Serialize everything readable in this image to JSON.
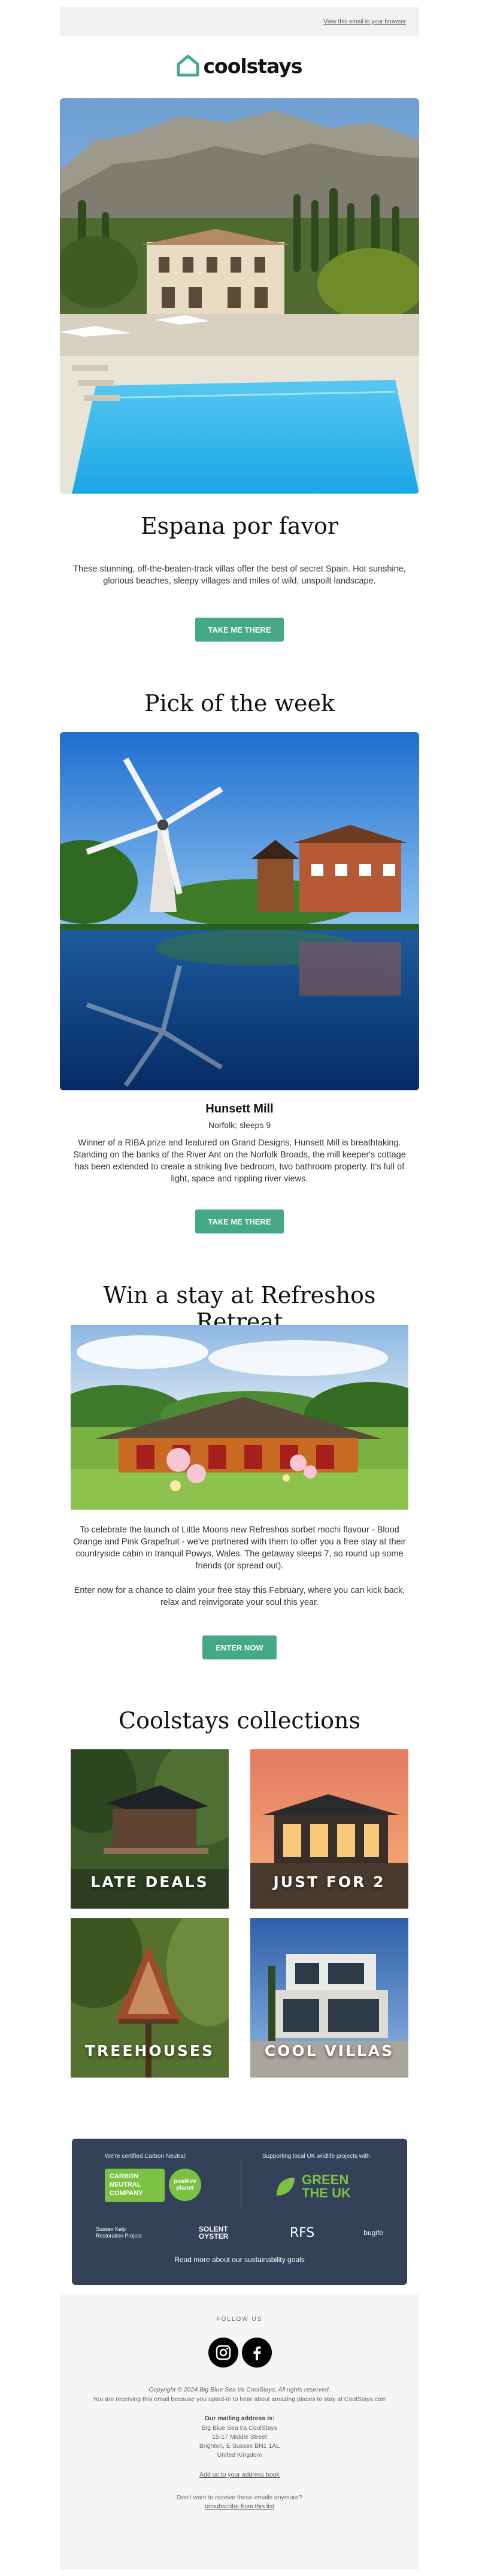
{
  "preheader": {
    "view_in_browser": "View this email in your browser"
  },
  "brand": {
    "name": "coolstays",
    "accent": "#44a889"
  },
  "hero": {
    "title": "Espana por favor",
    "text": "These stunning, off-the-beaten-track villas offer the best of secret Spain. Hot sunshine, glorious beaches, sleepy villages and miles of wild, unspoilt landscape.",
    "cta": "TAKE ME THERE"
  },
  "pick": {
    "heading": "Pick of the week",
    "name": "Hunsett Mill",
    "location": "Norfolk; sleeps 9",
    "text": "Winner of a RIBA prize and featured on Grand Designs, Hunsett Mill is breathtaking. Standing on the banks of the River Ant on the Norfolk Broads, the mill keeper's cottage has been extended to create a striking five bedroom, two bathroom property. It's full of light, space and rippling river views.",
    "cta": "TAKE ME THERE"
  },
  "competition": {
    "heading": "Win a stay at Refreshos Retreat",
    "text1": "To celebrate the launch of Little Moons new Refreshos sorbet mochi flavour - Blood Orange and Pink Grapefruit - we've partnered with them to offer you a free stay at their countryside cabin in tranquil Powys, Wales. The getaway sleeps 7, so round up some friends (or spread out).",
    "text2": "Enter now for a chance to claim your free stay this February, where you can kick back, relax and reinvigorate your soul this year.",
    "cta": "ENTER NOW"
  },
  "collections": {
    "heading": "Coolstays collections",
    "items": [
      {
        "label": "LATE DEALS"
      },
      {
        "label": "JUST FOR 2"
      },
      {
        "label": "TREEHOUSES"
      },
      {
        "label": "COOL VILLAS"
      }
    ]
  },
  "sustainability": {
    "certified": "We're certified Carbon Neutral:",
    "supporting": "Supporting local UK wildlife projects with",
    "carbon_badge": "CARBON NEUTRAL COMPANY",
    "positive_badge": "positive planet",
    "green_uk": "GREEN THE UK",
    "partners": [
      "Sussex Kelp Restoration Project",
      "SOLENT OYSTER",
      "RFS",
      "bugife"
    ],
    "link": "Read more about our sustainability goals"
  },
  "footer": {
    "follow": "FOLLOW US",
    "social": [
      "instagram-icon",
      "facebook-icon"
    ],
    "copyright": "Copyright © 2024 Big Blue Sea t/a CoolStays, All rights reserved.",
    "reason": "You are receiving this email because you opted-in to hear about amazing places to stay at CoolStays.com",
    "mailing_heading": "Our mailing address is:",
    "address": [
      "Big Blue Sea t/a CoolStays",
      "15-17 Middle Street",
      "Brighton, E Sussex BN1 1AL",
      "United Kingdom"
    ],
    "add_address": "Add us to your address book",
    "unsubscribe_q": "Don't want to receive these emails anymore?",
    "unsubscribe": "unsubscribe from this list"
  }
}
